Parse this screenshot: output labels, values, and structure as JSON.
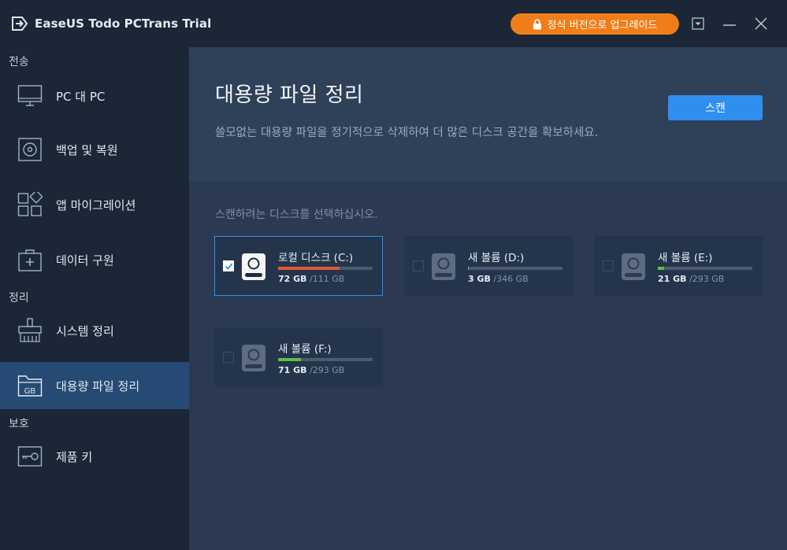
{
  "app": {
    "title": "EaseUS Todo PCTrans Trial",
    "upgrade_label": "정식 버전으로 업그레이드",
    "accent_color": "#2e8fef",
    "upgrade_color": "#f07d18"
  },
  "sidebar": {
    "sections": [
      {
        "label": "전송"
      },
      {
        "label": "정리"
      },
      {
        "label": "보호"
      }
    ],
    "items": [
      {
        "label": "PC 대 PC",
        "icon": "monitor-icon"
      },
      {
        "label": "백업 및 복원",
        "icon": "disc-icon"
      },
      {
        "label": "앱 마이그레이션",
        "icon": "apps-grid-icon"
      },
      {
        "label": "데이터 구원",
        "icon": "first-aid-kit-icon"
      },
      {
        "label": "시스템 정리",
        "icon": "broom-icon"
      },
      {
        "label": "대용량 파일 정리",
        "icon": "gb-folder-icon",
        "active": true
      },
      {
        "label": "제품 키",
        "icon": "key-icon"
      }
    ]
  },
  "main": {
    "title": "대용량 파일 정리",
    "description": "쓸모없는 대용량 파일을 정기적으로 삭제하여 더 많은 디스크 공간을 확보하세요.",
    "scan_label": "스캔",
    "select_prompt": "스캔하려는 디스크를 선택하십시오.",
    "disks": [
      {
        "name": "로컬 디스크 (C:)",
        "used": "72 GB",
        "total": "/111 GB",
        "fraction": 0.65,
        "bar_color": "#e8553a",
        "selected": true
      },
      {
        "name": "새 볼륨 (D:)",
        "used": "3 GB",
        "total": "/346 GB",
        "fraction": 0.01,
        "bar_color": "#5cc23a",
        "selected": false
      },
      {
        "name": "새 볼륨 (E:)",
        "used": "21 GB",
        "total": "/293 GB",
        "fraction": 0.07,
        "bar_color": "#5cc23a",
        "selected": false
      },
      {
        "name": "새 볼륨 (F:)",
        "used": "71 GB",
        "total": "/293 GB",
        "fraction": 0.24,
        "bar_color": "#5cc23a",
        "selected": false
      }
    ]
  }
}
